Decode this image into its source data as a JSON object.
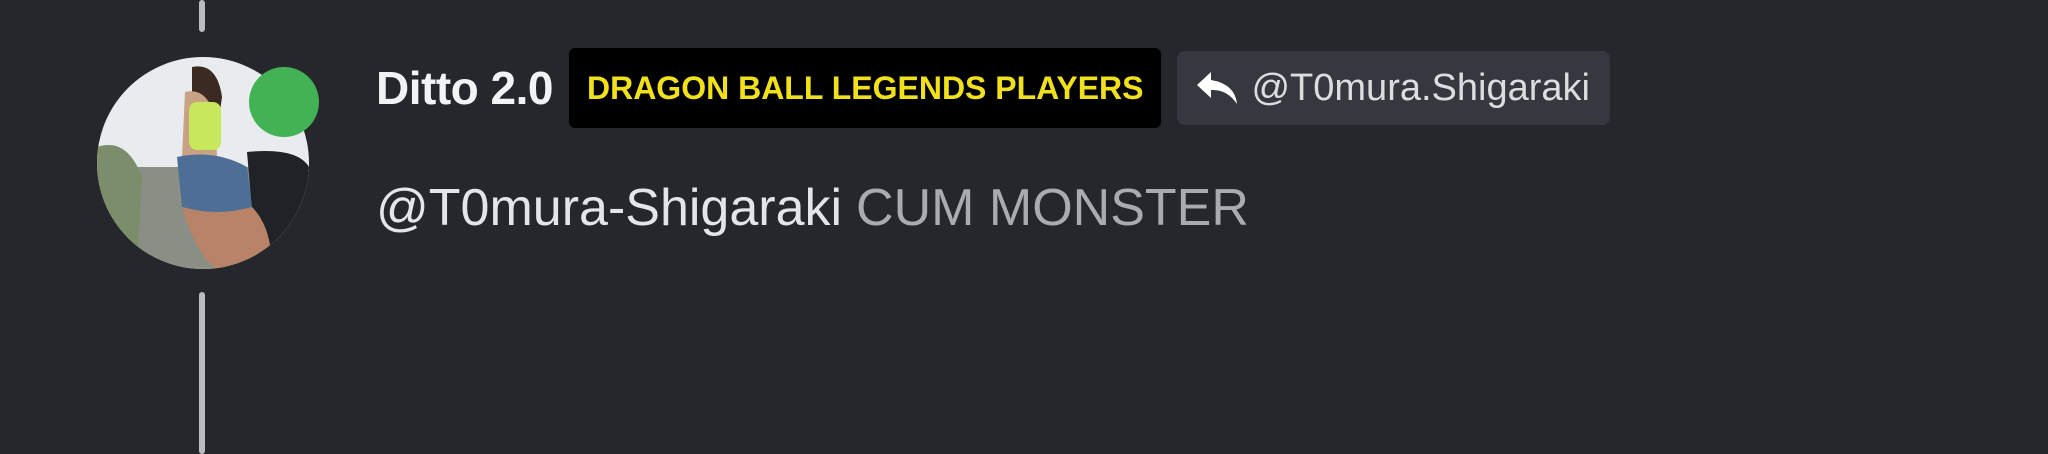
{
  "post": {
    "author": {
      "name": "Ditto 2.0",
      "status": "online",
      "status_color": "#43b254"
    },
    "role_tag": {
      "label": "DRAGON BALL LEGENDS PLAYERS",
      "text_color": "#f1e11a",
      "background": "#000000"
    },
    "reply_to": {
      "icon": "reply-arrow-icon",
      "label": "@T0mura.Shigaraki"
    },
    "message": {
      "mention": "@T0mura-Shigaraki",
      "text": "CUM MONSTER"
    }
  }
}
